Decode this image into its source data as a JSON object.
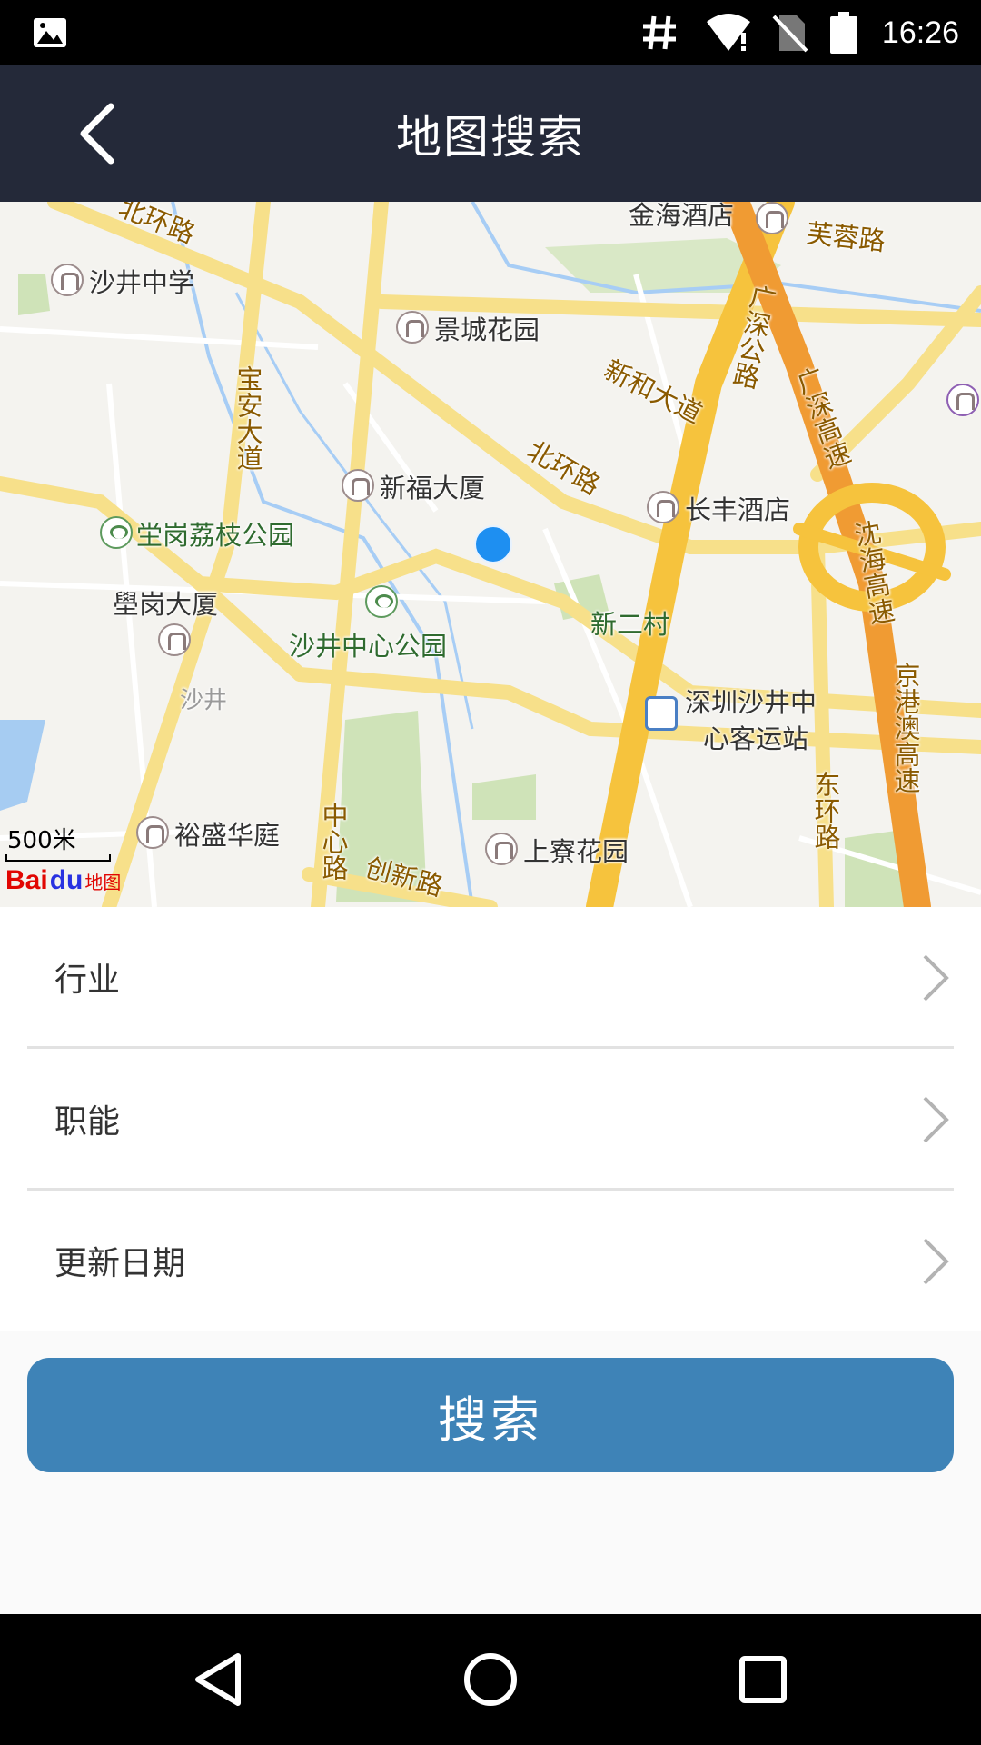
{
  "status_bar": {
    "time": "16:26",
    "icons": [
      "image-icon",
      "hash-icon",
      "wifi-icon",
      "no-sim-icon",
      "battery-icon"
    ]
  },
  "header": {
    "title": "地图搜索",
    "back_icon": "back-arrow-icon"
  },
  "map": {
    "scale": "500米",
    "logo_text": "Bai",
    "logo_du": "du",
    "logo_suffix": "地图",
    "roads": {
      "beihuan_top": "北环路",
      "baoan": "宝安大道",
      "xinhe": "新和大道",
      "beihuan_mid": "北环路",
      "furong": "芙蓉路",
      "guangshen": "广深公路",
      "guangshen_exp": "广深高速",
      "shenhai": "沈海高速",
      "jinggang": "京港澳高速",
      "donghuan": "东环路",
      "zhongxin": "中心路",
      "chuangxin": "创新路"
    },
    "pois": {
      "shajing_school": "沙井中学",
      "jingcheng": "景城花园",
      "xinfu": "新福大厦",
      "changfeng": "长丰酒店",
      "jinhai": "金海酒店",
      "kenggang_park": "坣岗荔枝公园",
      "kenggang_building": "壆岗大厦",
      "shajing_park": "沙井中心公园",
      "xinercun": "新二村",
      "shajing_station_1": "深圳沙井中",
      "shajing_station_2": "心客运站",
      "shajing_metro": "沙井",
      "yusheng": "裕盛华庭",
      "shangzhai": "上寮花园"
    }
  },
  "filters": [
    {
      "label": "行业",
      "icon": "chevron-right-icon"
    },
    {
      "label": "职能",
      "icon": "chevron-right-icon"
    },
    {
      "label": "更新日期",
      "icon": "chevron-right-icon"
    }
  ],
  "search_button": {
    "label": "搜索"
  },
  "nav_bar": {
    "icons": [
      "back-triangle-icon",
      "home-circle-icon",
      "recents-square-icon"
    ]
  },
  "colors": {
    "header_bg": "#242939",
    "button_bg": "#3e83b7",
    "location_dot": "#1e8ff1",
    "highway": "#f7a43a"
  }
}
